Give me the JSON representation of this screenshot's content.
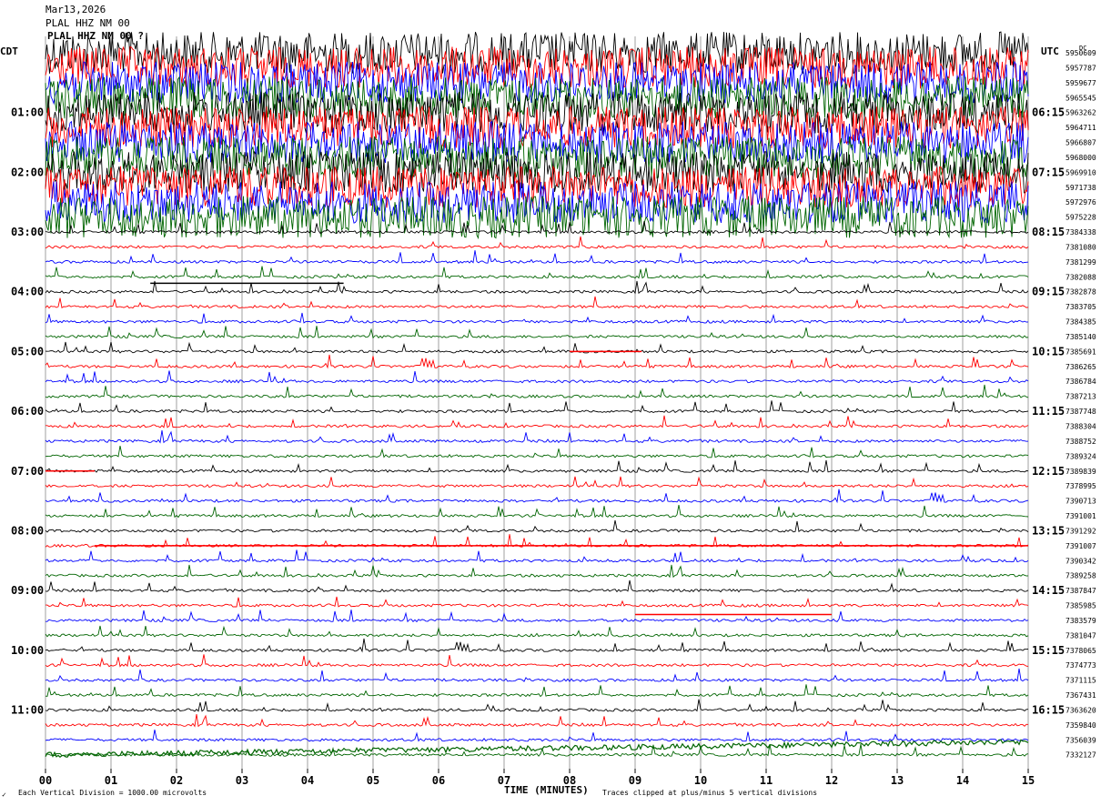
{
  "header": {
    "date": "Mar13,2026",
    "station": "PLAL HHZ NM 00",
    "station_overlap": "PLAL HHZ NM 00 ?"
  },
  "left_tz_label": "CDT",
  "right_tz_label": "UTC",
  "dc_label": "DC",
  "footer": {
    "scale_note": "Each Vertical Division = 1000.00 microvolts",
    "clip_note": "Traces clipped at plus/minus 5 vertical divisions",
    "corner_mark": "✓"
  },
  "chart_data": {
    "type": "line",
    "title": "",
    "xlabel": "TIME (MINUTES)",
    "xlim": [
      0,
      15
    ],
    "x_ticks": [
      "00",
      "01",
      "02",
      "03",
      "04",
      "05",
      "06",
      "07",
      "08",
      "09",
      "10",
      "11",
      "12",
      "13",
      "14",
      "15"
    ],
    "grid": "vertical lines every 1 minute",
    "line_colors": [
      "#000000",
      "#ff0000",
      "#0000ff",
      "#006400"
    ],
    "left_hour_labels": [
      "01:00",
      "02:00",
      "03:00",
      "04:00",
      "05:00",
      "06:00",
      "07:00",
      "08:00",
      "09:00",
      "10:00",
      "11:00"
    ],
    "right_hour_labels": [
      "06:15",
      "07:15",
      "08:15",
      "09:15",
      "10:15",
      "11:15",
      "12:15",
      "13:15",
      "14:15",
      "15:15",
      "16:15"
    ],
    "trace_dc_offsets": [
      "5950609",
      "5957787",
      "5959677",
      "5965545",
      "5963262",
      "5964711",
      "5966807",
      "5968000",
      "5969910",
      "5971738",
      "5972976",
      "5975228",
      "7384338",
      "7381080",
      "7381299",
      "7382088",
      "7382878",
      "7383705",
      "7384385",
      "7385140",
      "7385691",
      "7386265",
      "7386784",
      "7387213",
      "7387748",
      "7388304",
      "7388752",
      "7389324",
      "7389839",
      "7378995",
      "7390713",
      "7391001",
      "7391292",
      "7391007",
      "7390342",
      "7389258",
      "7387847",
      "7385985",
      "7383579",
      "7381047",
      "7378065",
      "7374773",
      "7371115",
      "7367431",
      "7363620",
      "7359840",
      "7356039",
      "7332127"
    ],
    "trace_count": 48,
    "noisy_trace_count": 12,
    "minutes_per_trace": 15
  }
}
